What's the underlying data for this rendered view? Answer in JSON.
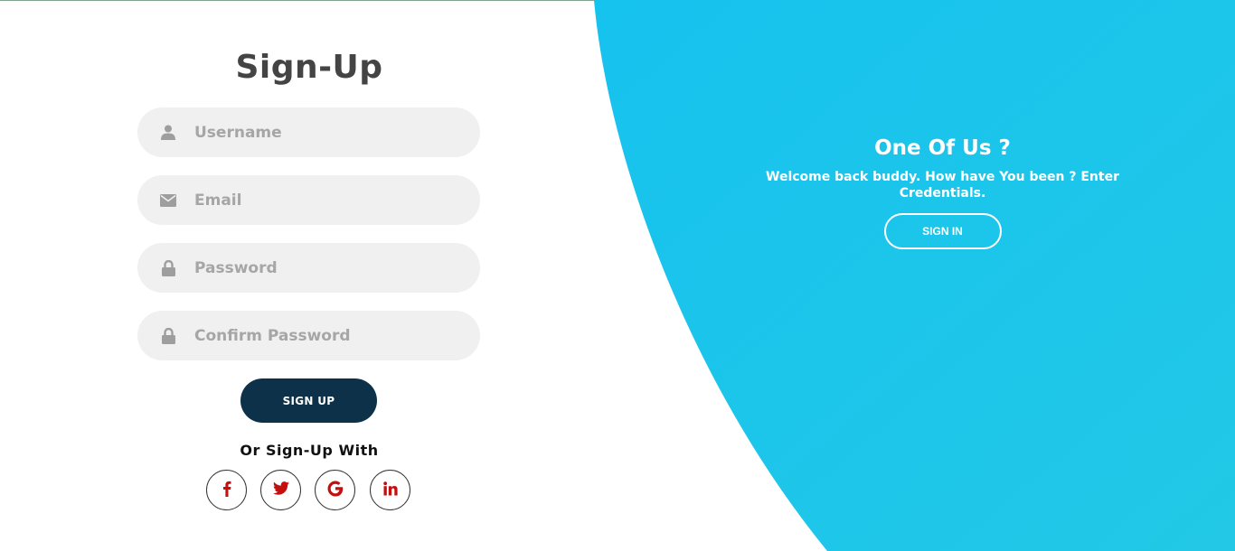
{
  "colors": {
    "accent_start": "#16c2ee",
    "accent_end": "#22c8e6",
    "primary_button": "#0c3149",
    "field_bg": "#f0f0f0",
    "social_icon": "#c40f0f"
  },
  "signup": {
    "title": "Sign-Up",
    "fields": [
      {
        "icon": "user-icon",
        "placeholder": "Username",
        "value": ""
      },
      {
        "icon": "envelope-icon",
        "placeholder": "Email",
        "value": ""
      },
      {
        "icon": "lock-icon",
        "placeholder": "Password",
        "value": ""
      },
      {
        "icon": "lock-icon",
        "placeholder": "Confirm Password",
        "value": ""
      }
    ],
    "button_label": "SIGN UP",
    "social_label": "Or Sign-Up With",
    "social_icons": [
      "facebook-icon",
      "twitter-icon",
      "google-icon",
      "linkedin-icon"
    ]
  },
  "panel": {
    "title": "One Of Us ?",
    "text": "Welcome back buddy. How have You been ? Enter Credentials.",
    "button_label": "SIGN IN"
  }
}
